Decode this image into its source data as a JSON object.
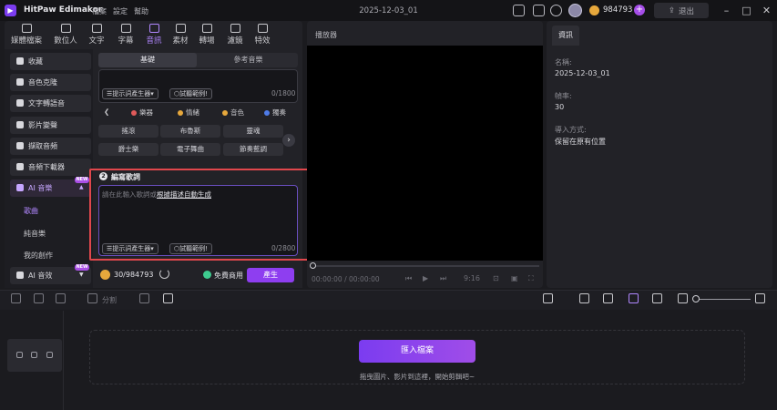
{
  "app": {
    "name": "HitPaw Edimakor",
    "menu": [
      "檔案",
      "設定",
      "幫助"
    ],
    "project_title": "2025-12-03_01",
    "coins": "984793",
    "coin_add": "+",
    "logout": "退出",
    "window_controls": [
      "–",
      "□",
      "✕"
    ]
  },
  "categories": [
    {
      "label": "媒體檔案",
      "icon": "media-icon"
    },
    {
      "label": "數位人",
      "icon": "avatar-icon"
    },
    {
      "label": "文字",
      "icon": "text-icon"
    },
    {
      "label": "字幕",
      "icon": "subtitle-icon"
    },
    {
      "label": "音訊",
      "icon": "music-note-icon",
      "active": true
    },
    {
      "label": "素材",
      "icon": "assets-icon"
    },
    {
      "label": "轉場",
      "icon": "transition-icon"
    },
    {
      "label": "濾鏡",
      "icon": "filter-icon"
    },
    {
      "label": "特效",
      "icon": "effects-icon"
    }
  ],
  "sidebar": {
    "items": [
      {
        "label": "收藏",
        "icon": "star-icon"
      },
      {
        "label": "音色克隆",
        "icon": "voice-clone-icon"
      },
      {
        "label": "文字轉語音",
        "icon": "tts-icon"
      },
      {
        "label": "影片變聲",
        "icon": "voice-changer-icon"
      },
      {
        "label": "擷取音頻",
        "icon": "microphone-icon"
      },
      {
        "label": "音頻下載器",
        "icon": "download-icon"
      },
      {
        "label": "AI 音樂",
        "icon": "ai-music-icon",
        "badge": "NEW"
      }
    ],
    "sub_items": [
      {
        "label": "歌曲",
        "active": true
      },
      {
        "label": "純音樂"
      },
      {
        "label": "我的創作"
      }
    ],
    "ai_sfx": {
      "label": "AI 音效",
      "badge": "NEW"
    }
  },
  "music_panel": {
    "tabs": [
      {
        "label": "基礎",
        "active": true
      },
      {
        "label": "參考音樂"
      }
    ],
    "prompt_helper": "提示詞產生器",
    "try_example": "試聽範例!",
    "prompt_counter": "0/1800",
    "style_tabs": [
      {
        "label": "",
        "color": "#d0d0d6"
      },
      {
        "label": "樂器",
        "color": "#e05a5a"
      },
      {
        "label": "情緒",
        "color": "#e7a83c"
      },
      {
        "label": "音色",
        "color": "#e7a83c"
      },
      {
        "label": "獨奏",
        "color": "#4e7be8"
      }
    ],
    "genres": [
      "搖滾",
      "布魯斯",
      "靈魂",
      "爵士樂",
      "電子舞曲",
      "節奏藍調"
    ],
    "lyrics": {
      "step": "2",
      "title": "編寫歌詞",
      "placeholder_prefix": "請在此輸入歌詞或",
      "placeholder_link": "根據描述自動生成",
      "prompt_helper": "提示詞產生器",
      "try_example": "試聽範例!",
      "counter": "0/2800"
    },
    "credits": "30/984793",
    "commercial": "免費商用",
    "generate": "產生"
  },
  "player": {
    "title": "播放器",
    "time": "00:00:00 / 00:00:00",
    "speed": "9:16"
  },
  "info": {
    "tab": "資訊",
    "name_label": "名稱:",
    "name_value": "2025-12-03_01",
    "fps_label": "幀率:",
    "fps_value": "30",
    "import_label": "導入方式:",
    "import_value": "保留在原有位置"
  },
  "timeline": {
    "split_label": "分割",
    "import_button": "匯入檔案",
    "drop_hint": "拖曳圖片、影片到這裡，開始剪輯吧~"
  }
}
